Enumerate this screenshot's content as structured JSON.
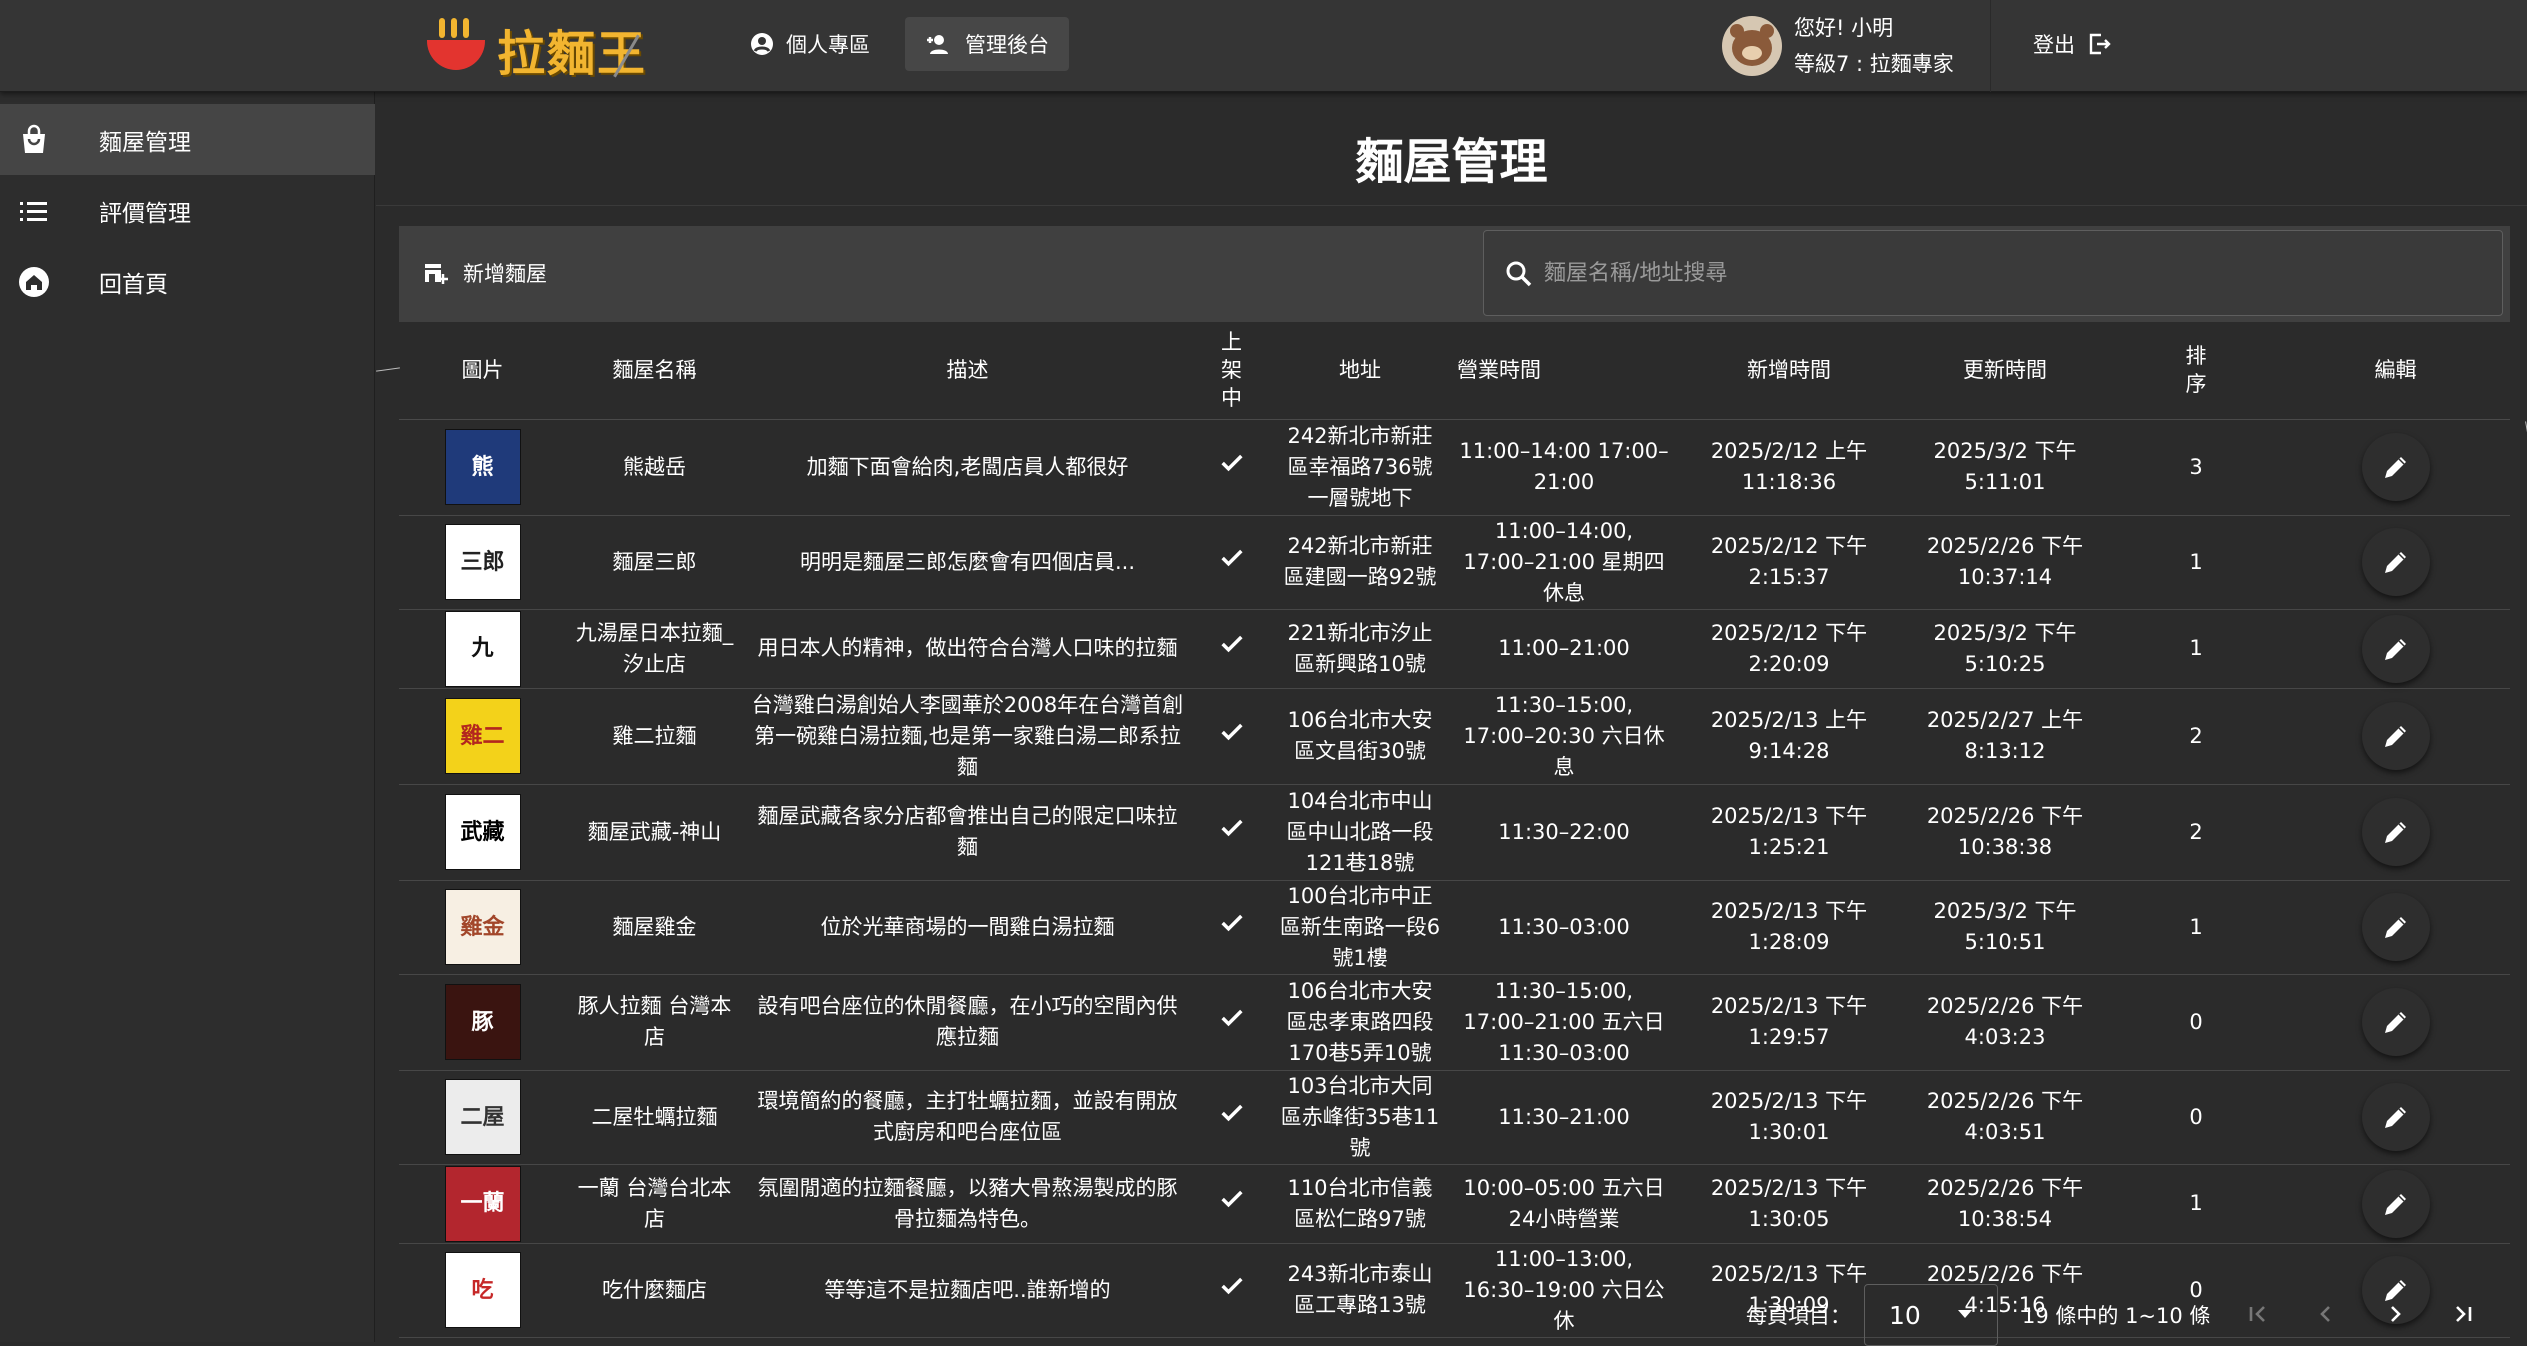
{
  "header": {
    "logo_text": "拉麵王",
    "nav": [
      {
        "label": "個人專區",
        "icon": "account-circle-icon"
      },
      {
        "label": "管理後台",
        "icon": "admin-user-icon"
      }
    ],
    "user": {
      "greeting": "您好! 小明",
      "level": "等級7 : 拉麵專家"
    },
    "logout_label": "登出"
  },
  "sidebar": {
    "items": [
      {
        "label": "麵屋管理",
        "icon": "shopping-bag-icon",
        "active": true
      },
      {
        "label": "評價管理",
        "icon": "list-icon",
        "active": false
      },
      {
        "label": "回首頁",
        "icon": "home-icon",
        "active": false
      }
    ]
  },
  "main": {
    "title": "麵屋管理",
    "add_label": "新增麵屋",
    "search_placeholder": "麵屋名稱/地址搜尋"
  },
  "table": {
    "columns": [
      "圖片",
      "麵屋名稱",
      "描述",
      "上架中",
      "地址",
      "營業時間",
      "新增時間",
      "更新時間",
      "排序",
      "編輯"
    ],
    "rows": [
      {
        "name": "熊越岳",
        "desc": "加麵下面會給肉,老闆店員人都很好",
        "addr": "242新北市新莊區幸福路736號一層號地下",
        "hours": "11:00–14:00 17:00–21:00",
        "created": "2025/2/12 上午11:18:36",
        "updated": "2025/3/2 下午5:11:01",
        "order": "3",
        "thumb": {
          "bg": "#1f3a7a",
          "fg": "#ffffff",
          "text": "熊"
        }
      },
      {
        "name": "麵屋三郎",
        "desc": "明明是麵屋三郎怎麼會有四個店員...",
        "addr": "242新北市新莊區建國一路92號",
        "hours": "11:00–14:00, 17:00–21:00 星期四休息",
        "created": "2025/2/12 下午2:15:37",
        "updated": "2025/2/26 下午10:37:14",
        "order": "1",
        "thumb": {
          "bg": "#ffffff",
          "fg": "#222222",
          "text": "三郎"
        }
      },
      {
        "name": "九湯屋日本拉麵_汐止店",
        "desc": "用日本人的精神，做出符合台灣人口味的拉麵",
        "addr": "221新北市汐止區新興路10號",
        "hours": "11:00–21:00",
        "created": "2025/2/12 下午2:20:09",
        "updated": "2025/3/2 下午5:10:25",
        "order": "1",
        "thumb": {
          "bg": "#ffffff",
          "fg": "#111111",
          "text": "九"
        }
      },
      {
        "name": "雞二拉麵",
        "desc": "台灣雞白湯創始人李國華於2008年在台灣首創第一碗雞白湯拉麵,也是第一家雞白湯二郎系拉麵",
        "addr": "106台北市大安區文昌街30號",
        "hours": "11:30–15:00, 17:00–20:30 六日休息",
        "created": "2025/2/13 上午9:14:28",
        "updated": "2025/2/27 上午8:13:12",
        "order": "2",
        "thumb": {
          "bg": "#f3d21a",
          "fg": "#b3261e",
          "text": "雞二"
        }
      },
      {
        "name": "麵屋武藏-神山",
        "desc": "麵屋武藏各家分店都會推出自己的限定口味拉麵",
        "addr": "104台北市中山區中山北路一段121巷18號",
        "hours": "11:30–22:00",
        "created": "2025/2/13 下午1:25:21",
        "updated": "2025/2/26 下午10:38:38",
        "order": "2",
        "thumb": {
          "bg": "#ffffff",
          "fg": "#000000",
          "text": "武藏"
        }
      },
      {
        "name": "麵屋雞金",
        "desc": "位於光華商場的一間雞白湯拉麵",
        "addr": "100台北市中正區新生南路一段6號1樓",
        "hours": "11:30–03:00",
        "created": "2025/2/13 下午1:28:09",
        "updated": "2025/3/2 下午5:10:51",
        "order": "1",
        "thumb": {
          "bg": "#f7efe3",
          "fg": "#a2462a",
          "text": "雞金"
        }
      },
      {
        "name": "豚人拉麵 台灣本店",
        "desc": "設有吧台座位的休閒餐廳，在小巧的空間內供應拉麵",
        "addr": "106台北市大安區忠孝東路四段170巷5弄10號",
        "hours": "11:30–15:00, 17:00–21:00 五六日11:30–03:00",
        "created": "2025/2/13 下午1:29:57",
        "updated": "2025/2/26 下午4:03:23",
        "order": "0",
        "thumb": {
          "bg": "#3a1410",
          "fg": "#ffffff",
          "text": "豚"
        }
      },
      {
        "name": "二屋牡蠣拉麵",
        "desc": "環境簡約的餐廳，主打牡蠣拉麵，並設有開放式廚房和吧台座位區",
        "addr": "103台北市大同區赤峰街35巷11號",
        "hours": "11:30–21:00",
        "created": "2025/2/13 下午1:30:01",
        "updated": "2025/2/26 下午4:03:51",
        "order": "0",
        "thumb": {
          "bg": "#ececec",
          "fg": "#333333",
          "text": "二屋"
        }
      },
      {
        "name": "一蘭 台灣台北本店",
        "desc": "氛圍閒適的拉麵餐廳，以豬大骨熬湯製成的豚骨拉麵為特色。",
        "addr": "110台北市信義區松仁路97號",
        "hours": "10:00–05:00 五六日24小時營業",
        "created": "2025/2/13 下午1:30:05",
        "updated": "2025/2/26 下午10:38:54",
        "order": "1",
        "thumb": {
          "bg": "#b3262e",
          "fg": "#ffffff",
          "text": "一蘭"
        }
      },
      {
        "name": "吃什麼麵店",
        "desc": "等等這不是拉麵店吧..誰新增的",
        "addr": "243新北市泰山區工專路13號",
        "hours": "11:00–13:00, 16:30–19:00 六日公休",
        "created": "2025/2/13 下午1:30:09",
        "updated": "2025/2/26 下午4:15:16",
        "order": "0",
        "thumb": {
          "bg": "#ffffff",
          "fg": "#c62828",
          "text": "吃"
        }
      }
    ]
  },
  "pagination": {
    "per_page_label": "每頁項目：",
    "per_page_value": "10",
    "range_text": "19 條中的 1~10 條"
  },
  "colors": {
    "background": "#2b2b2b",
    "topbar": "#353535",
    "toolbar": "#404040",
    "logo": "#f2b530",
    "bowl": "#e3342f"
  }
}
